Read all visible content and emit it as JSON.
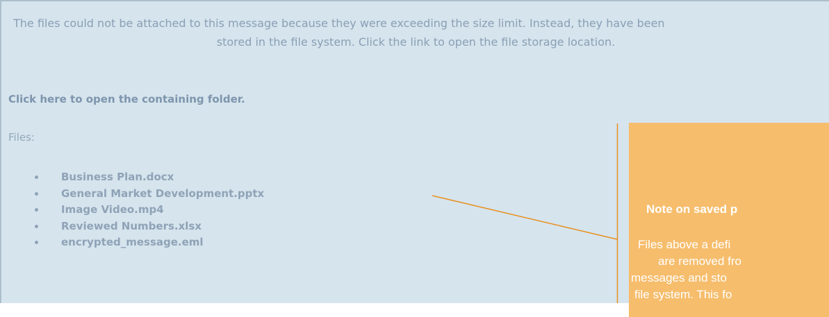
{
  "message": {
    "notice_line1": "The files could not be attached to this message because they were exceeding the size limit. Instead, they have been",
    "notice_line2": "stored in the file system. Click the link to open the file storage location.",
    "folder_link": "Click here to open the containing folder.",
    "files_label": "Files:",
    "files": [
      "Business Plan.docx",
      "General Market Development.pptx",
      "Image Video.mp4",
      "Reviewed Numbers.xlsx",
      "encrypted_message.eml"
    ]
  },
  "callout": {
    "title": "Note on saved p",
    "body_lines": [
      "Files above a defi",
      "are removed fro",
      "messages and sto",
      "file system. This fo"
    ],
    "background_color": "#f6bd6c",
    "line_color": "#e8901f"
  }
}
